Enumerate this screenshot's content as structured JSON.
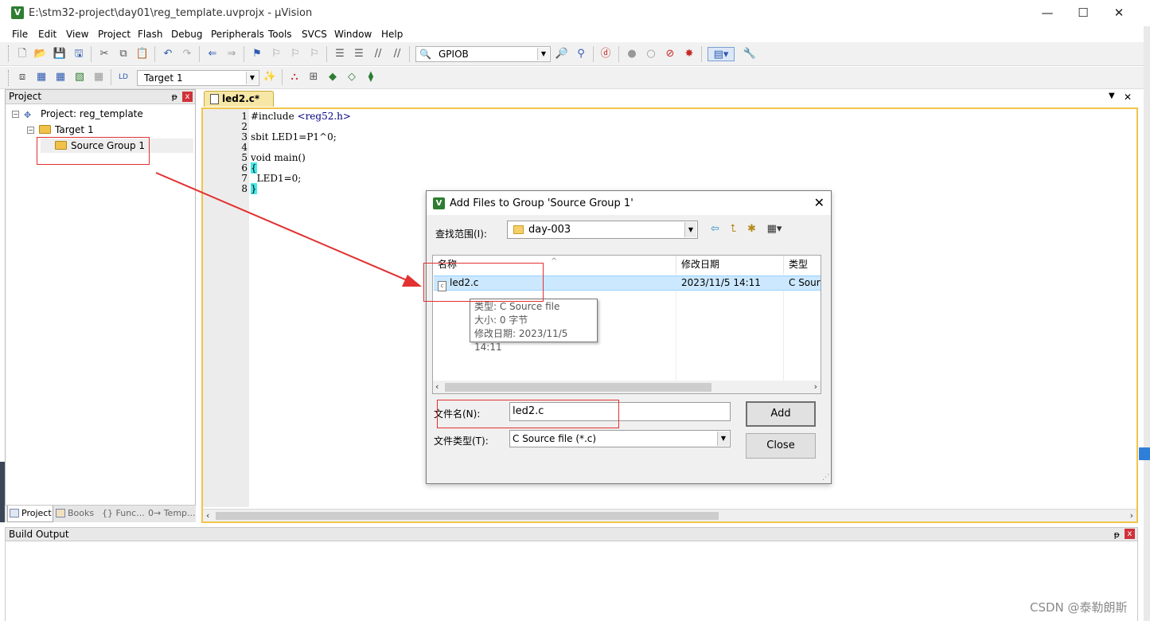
{
  "window": {
    "title": "E:\\stm32-project\\day01\\reg_template.uvprojx - µVision",
    "app_icon": "V",
    "minimize": "—",
    "maximize": "☐",
    "close": "✕"
  },
  "menu": [
    "File",
    "Edit",
    "View",
    "Project",
    "Flash",
    "Debug",
    "Peripherals",
    "Tools",
    "SVCS",
    "Window",
    "Help"
  ],
  "toolbar": {
    "find_combo": "GPIOB",
    "target_combo": "Target 1"
  },
  "project_panel": {
    "title": "Project",
    "pin": "ᵽ",
    "close": "x",
    "project_label": "Project: reg_template",
    "target_label": "Target 1",
    "group_label": "Source Group 1",
    "tabs": [
      "Project",
      "Books",
      "{} Func...",
      "0→ Temp..."
    ]
  },
  "editor": {
    "tab_label": "led2.c*",
    "line_numbers": [
      "1",
      "2",
      "3",
      "4",
      "5",
      "6",
      "7",
      "8"
    ],
    "lines": {
      "l1_directive": "#include ",
      "l1_header": "<reg52.h>",
      "l3": "sbit LED1=P1^0;",
      "l5": "void main()",
      "l6": "{",
      "l7": "  LED1=0;",
      "l8": "}"
    }
  },
  "build_output": {
    "title": "Build Output",
    "pin": "ᵽ",
    "close": "x"
  },
  "dialog": {
    "title": "Add Files to Group 'Source Group 1'",
    "icon": "V",
    "close": "✕",
    "look_in_label": "查找范围(I):",
    "look_in_value": "day-003",
    "columns": [
      "名称",
      "修改日期",
      "类型"
    ],
    "sort_caret": "^",
    "file": {
      "icon": "c",
      "name": "led2.c",
      "modified": "2023/11/5 14:11",
      "type": "C Sourc"
    },
    "tooltip": {
      "type_line": "类型: C Source file",
      "size_line": "大小: 0 字节",
      "date_line": "修改日期: 2023/11/5 14:11"
    },
    "filename_label": "文件名(N):",
    "filename_value": "led2.c",
    "filetype_label": "文件类型(T):",
    "filetype_value": "C Source file (*.c)",
    "add_button": "Add",
    "close_button": "Close"
  },
  "watermark": "CSDN @泰勒朗斯",
  "colors": {
    "annotation_red": "#e23131",
    "editor_border": "#f1c44a",
    "selection_blue": "#cce8ff"
  }
}
